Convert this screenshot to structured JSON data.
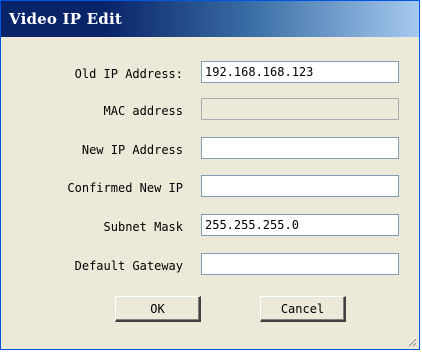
{
  "window": {
    "title": "Video IP Edit"
  },
  "form": {
    "old_ip_label": "Old IP Address:",
    "old_ip_value": "192.168.168.123",
    "mac_label": "MAC address",
    "mac_value": "",
    "new_ip_label": "New IP Address",
    "new_ip_value": "",
    "confirm_ip_label": "Confirmed New IP",
    "confirm_ip_value": "",
    "subnet_label": "Subnet Mask",
    "subnet_value": "255.255.255.0",
    "gateway_label": "Default Gateway",
    "gateway_value": ""
  },
  "buttons": {
    "ok_label": "OK",
    "cancel_label": "Cancel"
  },
  "colors": {
    "titlebar_start": "#0a246a",
    "titlebar_end": "#a6caf0",
    "dialog_background": "#ece9d8",
    "field_border": "#7f9db9"
  },
  "icons": {
    "resize_grip": "resize-grip-icon"
  }
}
